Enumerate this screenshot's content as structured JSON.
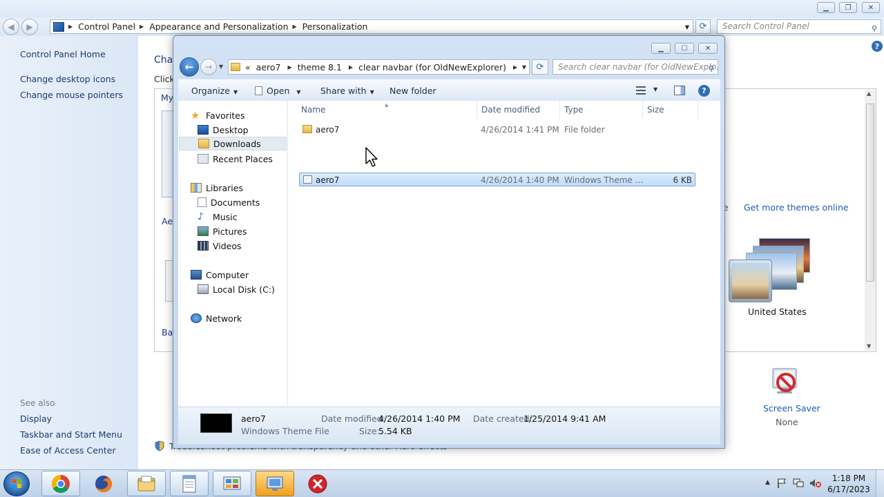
{
  "control_panel": {
    "breadcrumb": [
      "Control Panel",
      "Appearance and Personalization",
      "Personalization"
    ],
    "search_placeholder": "Search Control Panel",
    "left_links": [
      "Control Panel Home",
      "Change desktop icons",
      "Change mouse pointers"
    ],
    "see_also_label": "See also",
    "see_also_links": [
      "Display",
      "Taskbar and Start Menu",
      "Ease of Access Center"
    ],
    "heading_fragment": "Cha",
    "click_fragment": "Click",
    "my_fragment": "My",
    "aero_fragment": "Aer",
    "basic_fragment": "Bas",
    "e_fragment": "e",
    "get_more_themes": "Get more themes online",
    "theme_name": "United States",
    "screen_saver_label": "Screen Saver",
    "screen_saver_value": "None",
    "troubleshoot_text": "Troubleshoot problems with transparency and other Aero effects"
  },
  "explorer": {
    "breadcrumb_prefix": "«",
    "breadcrumb": [
      "aero7",
      "theme 8.1",
      "clear navbar (for OldNewExplorer)"
    ],
    "search_placeholder": "Search clear navbar (for OldNewExplo...",
    "toolbar": {
      "organize": "Organize",
      "open": "Open",
      "share_with": "Share with",
      "new_folder": "New folder"
    },
    "nav": {
      "favorites": "Favorites",
      "favorites_items": [
        "Desktop",
        "Downloads",
        "Recent Places"
      ],
      "libraries": "Libraries",
      "libraries_items": [
        "Documents",
        "Music",
        "Pictures",
        "Videos"
      ],
      "computer": "Computer",
      "computer_items": [
        "Local Disk (C:)"
      ],
      "network": "Network"
    },
    "columns": [
      "Name",
      "Date modified",
      "Type",
      "Size"
    ],
    "files": [
      {
        "name": "aero7",
        "date": "4/26/2014 1:41 PM",
        "type": "File folder",
        "size": ""
      },
      {
        "name": "aero7",
        "date": "4/26/2014 1:40 PM",
        "type": "Windows Theme ...",
        "size": "6 KB"
      }
    ],
    "details": {
      "name": "aero7",
      "type": "Windows Theme File",
      "date_modified_label": "Date modified:",
      "date_modified": "4/26/2014 1:40 PM",
      "date_created_label": "Date created:",
      "date_created": "1/25/2014 9:41 AM",
      "size_label": "Size:",
      "size": "5.54 KB"
    }
  },
  "taskbar": {
    "apps": [
      "chrome-icon",
      "firefox-icon",
      "explorer-icon",
      "notepad-icon",
      "control-panel-icon",
      "personalization-icon",
      "error-icon"
    ],
    "time": "1:18 PM",
    "date": "6/17/2023"
  },
  "colors": {
    "link_blue": "#1e5bb0",
    "selection_blue": "#c1dbfc",
    "title_bar": "#dce9f7"
  }
}
